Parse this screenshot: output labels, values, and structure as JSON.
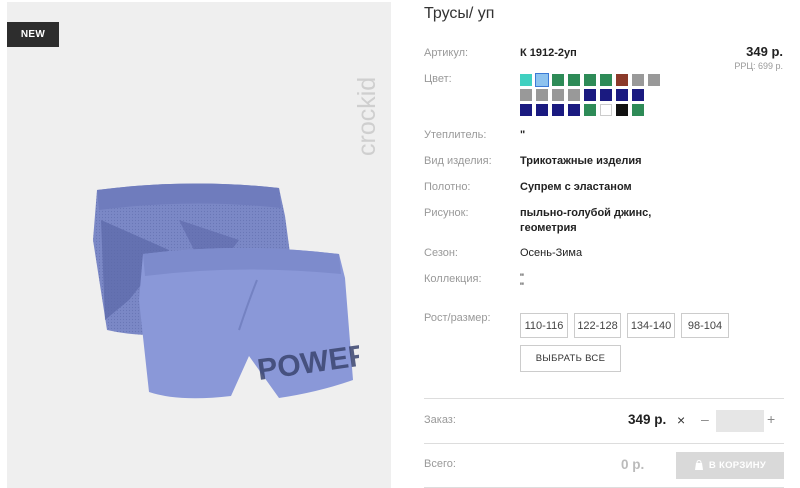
{
  "badge": "NEW",
  "brand": "crockid",
  "product": {
    "title": "Трусы/ уп",
    "price": "349 р.",
    "rrp": "РРЦ: 699 р."
  },
  "details": {
    "article_label": "Артикул:",
    "article_value": "К 1912-2уп",
    "color_label": "Цвет:",
    "insulation_label": "Утеплитель:",
    "insulation_value": "\"",
    "type_label": "Вид изделия:",
    "type_value": "Трикотажные изделия",
    "fabric_label": "Полотно:",
    "fabric_value": "Супрем с эластаном",
    "pattern_label": "Рисунок:",
    "pattern_value_1": "пыльно-голубой джинс,",
    "pattern_value_2": "геометрия",
    "season_label": "Сезон:",
    "season_value": "Осень-Зима",
    "collection_label": "Коллекция:",
    "collection_value_1": "\"",
    "collection_value_2": "\"",
    "size_label": "Рост/размер:"
  },
  "swatch_colors": [
    "#40d0c0",
    "#8ec3ef",
    "#2e8b57",
    "#2e8b57",
    "#2e8b57",
    "#2e8b57",
    "#8b3a2a",
    "#999999",
    "#999999",
    "#999999",
    "#999999",
    "#999999",
    "#999999",
    "#1a1a80",
    "#1a1a80",
    "#1a1a80",
    "#1a1a80",
    "#1a1a80",
    "#1a1a80",
    "#1a1a80",
    "#1a1a80",
    "#2e8b57",
    "#ffffff",
    "#111111",
    "#2e8b57"
  ],
  "selected_swatch": 1,
  "sizes": [
    "110-116",
    "122-128",
    "134-140",
    "98-104"
  ],
  "select_all": "ВЫБРАТЬ ВСЕ",
  "order": {
    "label": "Заказ:",
    "price": "349 р.",
    "times": "×",
    "minus": "–",
    "plus": "+",
    "qty": ""
  },
  "total": {
    "label": "Всего:",
    "price": "0 р.",
    "cart_button": "В КОРЗИНУ"
  },
  "print_text": "POWER"
}
